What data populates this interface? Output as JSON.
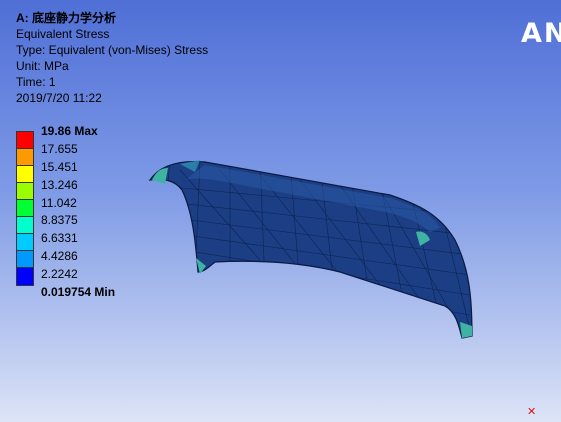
{
  "header": {
    "title": "A: 底座静力学分析",
    "result_name": "Equivalent Stress",
    "type_line": "Type: Equivalent (von-Mises) Stress",
    "unit_line": "Unit: MPa",
    "time_line": "Time: 1",
    "date_line": "2019/7/20 11:22"
  },
  "brand": {
    "text": "ANSYS"
  },
  "legend": {
    "max_label": "19.86 Max",
    "min_label": "0.019754 Min",
    "levels": [
      "17.655",
      "15.451",
      "13.246",
      "11.042",
      "8.8375",
      "6.6331",
      "4.4286",
      "2.2242"
    ],
    "colors": [
      "#ff0000",
      "#ff9900",
      "#ffff00",
      "#99ff00",
      "#00ff33",
      "#00ffcc",
      "#00ccff",
      "#0099ff",
      "#0000ff"
    ]
  },
  "model": {
    "fill_color": "#1c3e84",
    "accent_color": "#3fb3a3",
    "mesh_color": "#0b1d48"
  },
  "triad": {
    "x_symbol": "✕"
  }
}
